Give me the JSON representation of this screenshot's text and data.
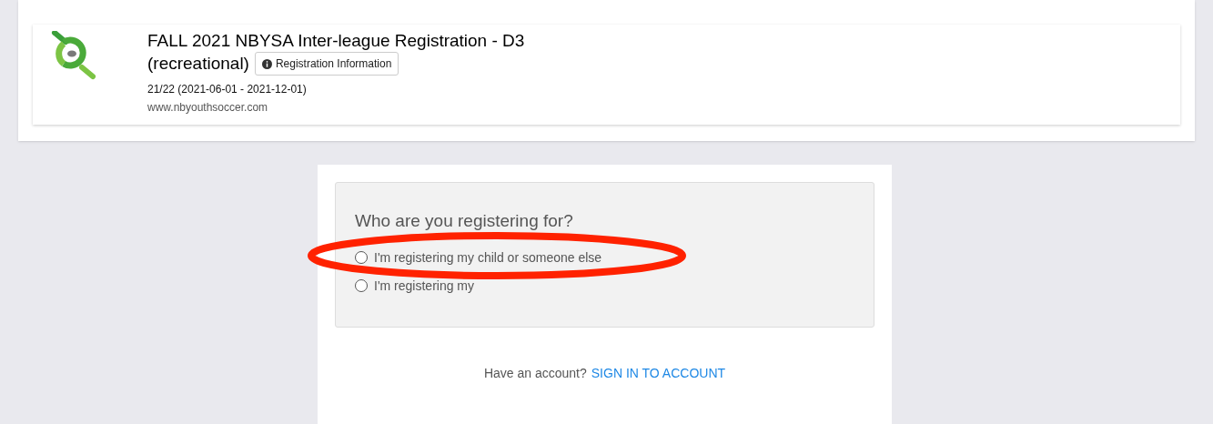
{
  "event": {
    "title_line1": "FALL 2021 NBYSA Inter-league Registration - D3",
    "title_line2": "(recreational)",
    "info_button": "Registration Information",
    "season": "21/22 (2021-06-01 - 2021-12-01)",
    "website": "www.nbyouthsoccer.com"
  },
  "form": {
    "question": "Who are you registering for?",
    "options": [
      {
        "label": "I'm registering my child or someone else",
        "selected": false
      },
      {
        "label": "I'm registering my",
        "selected": false
      }
    ],
    "account_prompt": "Have an account?",
    "sign_in_link": "SIGN IN TO ACCOUNT"
  }
}
